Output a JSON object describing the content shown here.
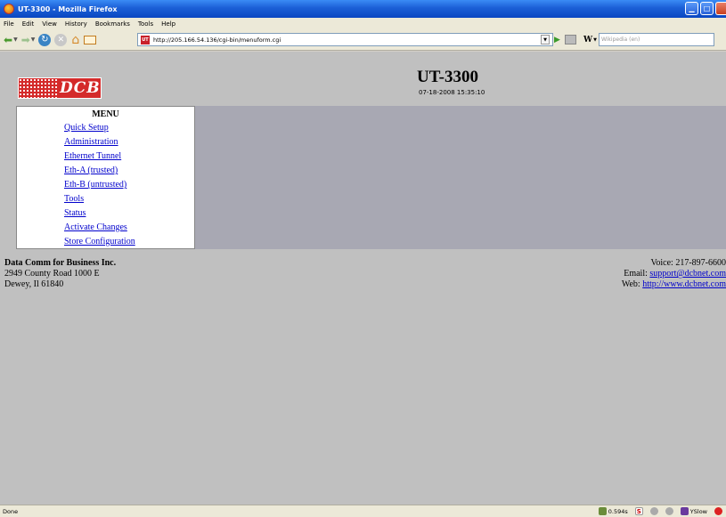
{
  "window": {
    "title": "UT-3300 - Mozilla Firefox"
  },
  "menubar": {
    "items": [
      "File",
      "Edit",
      "View",
      "History",
      "Bookmarks",
      "Tools",
      "Help"
    ]
  },
  "toolbar": {
    "url": "http://205.166.54.136/cgi-bin/menuform.cgi",
    "site_icon_text": "UT",
    "search_engine": "W",
    "search_placeholder": "Wikipedia (en)"
  },
  "page": {
    "logo_text": "DCB",
    "title": "UT-3300",
    "datetime": "07-18-2008 15:35:10",
    "menu": {
      "title": "MENU",
      "items": [
        "Quick Setup",
        "Administration",
        "Ethernet Tunnel",
        "Eth-A (trusted)",
        "Eth-B (untrusted)",
        "Tools",
        "Status",
        "Activate Changes",
        "Store Configuration"
      ]
    },
    "footer": {
      "company": "Data Comm for Business Inc.",
      "address1": "2949 County Road 1000 E",
      "address2": "Dewey, Il 61840",
      "voice": "Voice: 217-897-6600",
      "email_label": "Email: ",
      "email": "support@dcbnet.com",
      "web_label": "Web: ",
      "web": "http://www.dcbnet.com"
    }
  },
  "statusbar": {
    "status": "Done",
    "timing": "0.594s",
    "yslow": "YSlow"
  },
  "colors": {
    "titlebar": "#0a47c2",
    "content_bg": "#c0c0c0",
    "panel_gray": "#a8a8b3",
    "link": "#0000cc",
    "logo_red": "#d42a2a"
  }
}
